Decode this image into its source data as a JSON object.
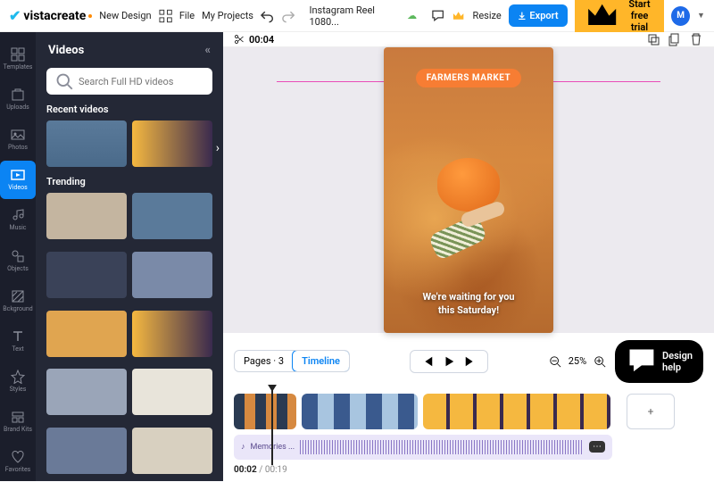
{
  "header": {
    "logo_text": "vistacreate",
    "new_design": "New Design",
    "file": "File",
    "my_projects": "My Projects",
    "doc_title": "Instagram Reel 1080...",
    "resize": "Resize",
    "export": "Export",
    "trial": "Start free trial",
    "avatar": "M"
  },
  "sidebar": {
    "items": [
      {
        "label": "Templates"
      },
      {
        "label": "Uploads"
      },
      {
        "label": "Photos"
      },
      {
        "label": "Videos"
      },
      {
        "label": "Music"
      },
      {
        "label": "Objects"
      },
      {
        "label": "Bckground"
      },
      {
        "label": "Text"
      },
      {
        "label": "Styles"
      },
      {
        "label": "Brand Kits"
      },
      {
        "label": "Favorites"
      }
    ]
  },
  "panel": {
    "title": "Videos",
    "search_placeholder": "Search Full HD videos",
    "recent": "Recent videos",
    "trending": "Trending"
  },
  "canvas": {
    "time": "00:04",
    "badge": "FARMERS MARKET",
    "caption_l1": "We're waiting for you",
    "caption_l2": "this Saturday!"
  },
  "controls": {
    "pages": "Pages · 3",
    "timeline": "Timeline",
    "zoom": "25%",
    "design_help": "Design help"
  },
  "timeline": {
    "audio_label": "Memories ...",
    "current": "00:02",
    "sep": " / ",
    "total": "00:19",
    "add": "+"
  }
}
